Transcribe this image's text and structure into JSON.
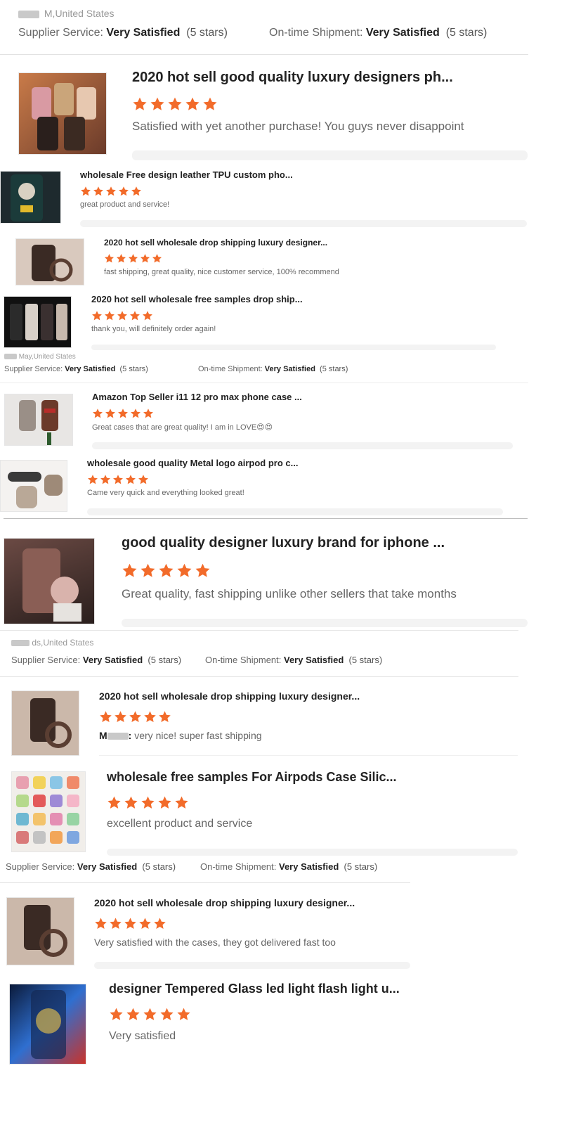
{
  "theme": {
    "star_color": "#f26b2a"
  },
  "rating_labels": {
    "supplier": "Supplier Service:",
    "shipment": "On-time Shipment:",
    "level": "Very Satisfied",
    "stars_text": "(5 stars)"
  },
  "sections": [
    {
      "location": "M,United States"
    },
    {
      "location": "May,United States"
    },
    {
      "location": "ds,United States"
    }
  ],
  "reviews": [
    {
      "title": "2020 hot sell good quality luxury designers ph...",
      "text": "Satisfied with yet another purchase! You guys never disappoint",
      "rating": 5
    },
    {
      "title": "wholesale Free design leather TPU custom pho...",
      "text": "great product and service!",
      "rating": 5
    },
    {
      "title": "2020 hot sell wholesale drop shipping luxury designer...",
      "text": "fast shipping, great quality, nice customer service, 100% recommend",
      "rating": 5
    },
    {
      "title": "2020 hot sell wholesale free samples drop ship...",
      "text": "thank you, will definitely order again!",
      "rating": 5
    },
    {
      "title": "Amazon Top Seller i11 12 pro max phone case ...",
      "text": "Great cases that are great quality! I am in LOVE😍😍",
      "rating": 5
    },
    {
      "title": "wholesale good quality Metal logo airpod pro c...",
      "text": "Came very quick and everything looked great!",
      "rating": 5
    },
    {
      "title": "good quality designer luxury brand for iphone ...",
      "text": "Great quality, fast shipping unlike other sellers that take months",
      "rating": 5
    },
    {
      "title": "2020 hot sell wholesale drop shipping luxury designer...",
      "text_prefix": "M",
      "text_prefix_end": ":",
      "text": "very nice! super fast shipping",
      "rating": 5
    },
    {
      "title": "wholesale free samples For Airpods Case Silic...",
      "text": "excellent product and service",
      "rating": 5
    },
    {
      "title": "2020 hot sell wholesale drop shipping luxury designer...",
      "text": "Very satisfied with the cases, they got delivered fast too",
      "rating": 5
    },
    {
      "title": "designer Tempered Glass led light flash light u...",
      "text": "Very satisfied",
      "rating": 5
    }
  ]
}
